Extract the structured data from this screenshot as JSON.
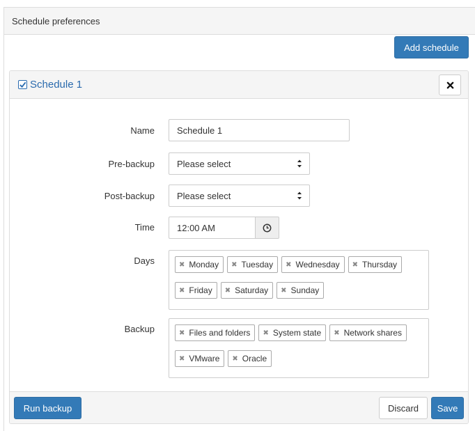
{
  "header": {
    "title": "Schedule preferences"
  },
  "toolbar": {
    "add_label": "Add schedule"
  },
  "schedule": {
    "title": "Schedule 1",
    "checked": true,
    "close_icon": "close-icon"
  },
  "form": {
    "name_label": "Name",
    "name_value": "Schedule 1",
    "pre_label": "Pre-backup",
    "pre_value": "Please select",
    "post_label": "Post-backup",
    "post_value": "Please select",
    "time_label": "Time",
    "time_value": "12:00 AM",
    "days_label": "Days",
    "days": [
      "Monday",
      "Tuesday",
      "Wednesday",
      "Thursday",
      "Friday",
      "Saturday",
      "Sunday"
    ],
    "backup_label": "Backup",
    "backup": [
      "Files and folders",
      "System state",
      "Network shares",
      "VMware",
      "Oracle"
    ]
  },
  "footer": {
    "run_label": "Run backup",
    "discard_label": "Discard",
    "save_label": "Save"
  },
  "colors": {
    "primary": "#337ab7",
    "title_link": "#2a6aad",
    "panel_header": "#f5f5f5"
  }
}
